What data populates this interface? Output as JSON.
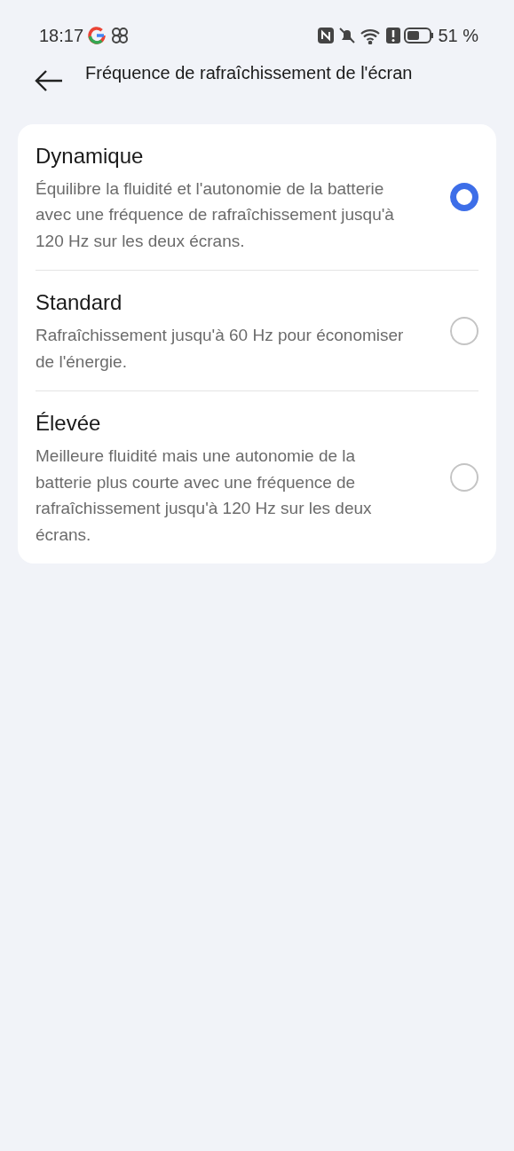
{
  "status_bar": {
    "time": "18:17",
    "battery_text": "51 %"
  },
  "header": {
    "title": "Fréquence de rafraîchissement de l'écran"
  },
  "options": [
    {
      "title": "Dynamique",
      "description": "Équilibre la fluidité et l'autonomie de la batterie avec une fréquence de rafraîchissement jusqu'à 120 Hz sur les deux écrans.",
      "selected": true
    },
    {
      "title": "Standard",
      "description": "Rafraîchissement jusqu'à 60 Hz pour économiser de l'énergie.",
      "selected": false
    },
    {
      "title": "Élevée",
      "description": "Meilleure fluidité mais une autonomie de la batterie plus courte avec une fréquence de rafraîchissement jusqu'à 120 Hz sur les deux écrans.",
      "selected": false
    }
  ]
}
